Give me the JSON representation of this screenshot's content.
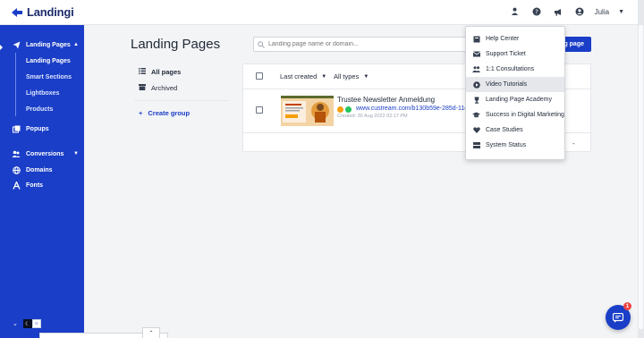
{
  "app": {
    "logo_text": "Landingi"
  },
  "topbar": {
    "user_name": "Julia",
    "icons": [
      "person-icon",
      "help-icon",
      "megaphone-icon",
      "user-avatar-icon"
    ]
  },
  "sidebar": {
    "items": [
      {
        "label": "Landing Pages",
        "icon": "paper-plane-icon"
      },
      {
        "label": "Popups",
        "icon": "popup-icon"
      },
      {
        "label": "Conversions",
        "icon": "users-icon"
      },
      {
        "label": "Domains",
        "icon": "globe-icon"
      },
      {
        "label": "Fonts",
        "icon": "font-icon"
      }
    ],
    "sub_items": [
      "Landing Pages",
      "Smart Sections",
      "Lightboxes",
      "Products"
    ]
  },
  "main": {
    "title": "Landing Pages",
    "search_placeholder": "Landing page name or domain...",
    "create_button_label": "g page"
  },
  "filters": {
    "all_pages": "All pages",
    "archived": "Archived",
    "create_group": "Create group"
  },
  "table": {
    "sort_label": "Last created",
    "type_label": "All types",
    "rows": [
      {
        "name": "Trustee Newsletter Anmeldung",
        "url": "www.custream.com/b130b59e-285d-11e",
        "created": "Created: 30 Aug 2022 02:17 PM"
      }
    ],
    "pager_text": "-"
  },
  "dropdown": {
    "items": [
      {
        "label": "Help Center",
        "icon": "book-icon"
      },
      {
        "label": "Support Ticket",
        "icon": "envelope-icon"
      },
      {
        "label": "1:1 Consultations",
        "icon": "people-icon"
      },
      {
        "label": "Video Tutorials",
        "icon": "play-circle-icon"
      },
      {
        "label": "Landing Page Academy",
        "icon": "trophy-icon"
      },
      {
        "label": "Success in Digital Marketing",
        "icon": "graduation-cap-icon"
      },
      {
        "label": "Case Studies",
        "icon": "heart-icon"
      },
      {
        "label": "System Status",
        "icon": "server-icon"
      }
    ],
    "active_index": 3
  },
  "chat": {
    "badge": "1"
  },
  "colors": {
    "brand": "#1a3ec7",
    "sidebar": "#1a3ec7",
    "text": "#1f2937",
    "link": "#1a3ec7"
  }
}
